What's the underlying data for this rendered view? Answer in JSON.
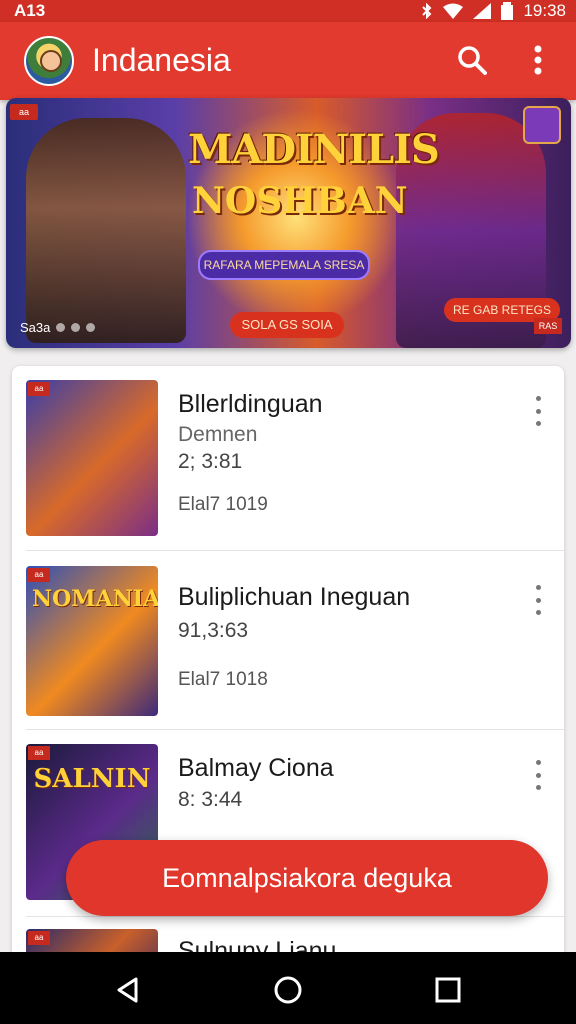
{
  "status_bar": {
    "left": "A13",
    "time": "19:38"
  },
  "app_bar": {
    "title": "Indanesia"
  },
  "banner": {
    "corner_badge": "aa",
    "title_line1": "MADINILIS",
    "title_line2": "NOSHBAN",
    "subtitle": "RAFARA MEPEMALA SRESA",
    "dots_text": "Sa3a",
    "cta": "SOLA GS SOIA",
    "cta2": "RE GAB RETEGS",
    "corner_tag": "RAS"
  },
  "list": [
    {
      "title": "Bllerldinguan",
      "subtitle": "Demnen",
      "count": "2; 3:81",
      "date": "Elal7 1019",
      "thumb_label": "",
      "thumb_badge": "aa",
      "thumb_colors": [
        "#3a3ea8",
        "#d86a2a",
        "#7a2f86"
      ]
    },
    {
      "title": "Buliplichuan Ineguan",
      "subtitle": "",
      "count": "91,3:63",
      "date": "Elal7 1018",
      "thumb_label": "NOMANIAS",
      "thumb_badge": "aa",
      "thumb_colors": [
        "#2c4fb8",
        "#f08a20",
        "#3e2a7a"
      ]
    },
    {
      "title": "Balmay Ciona",
      "subtitle": "",
      "count": "8: 3:44",
      "date": "",
      "thumb_label": "SALNIN",
      "thumb_badge": "aa",
      "thumb_colors": [
        "#1a1a3a",
        "#5b2a8a",
        "#2a6a4a"
      ]
    },
    {
      "title": "Sulnuny Lianu",
      "subtitle": "",
      "count": "",
      "date": "",
      "thumb_label": "",
      "thumb_badge": "aa",
      "thumb_colors": [
        "#2a2a6a",
        "#c8602a",
        "#4a2a5a"
      ]
    }
  ],
  "fab": {
    "label": "Eomnalpsiakora deguka"
  },
  "icons": {
    "search": "search-icon",
    "overflow": "more-vert-icon",
    "back": "back-icon",
    "home": "home-icon",
    "recents": "recents-icon"
  }
}
